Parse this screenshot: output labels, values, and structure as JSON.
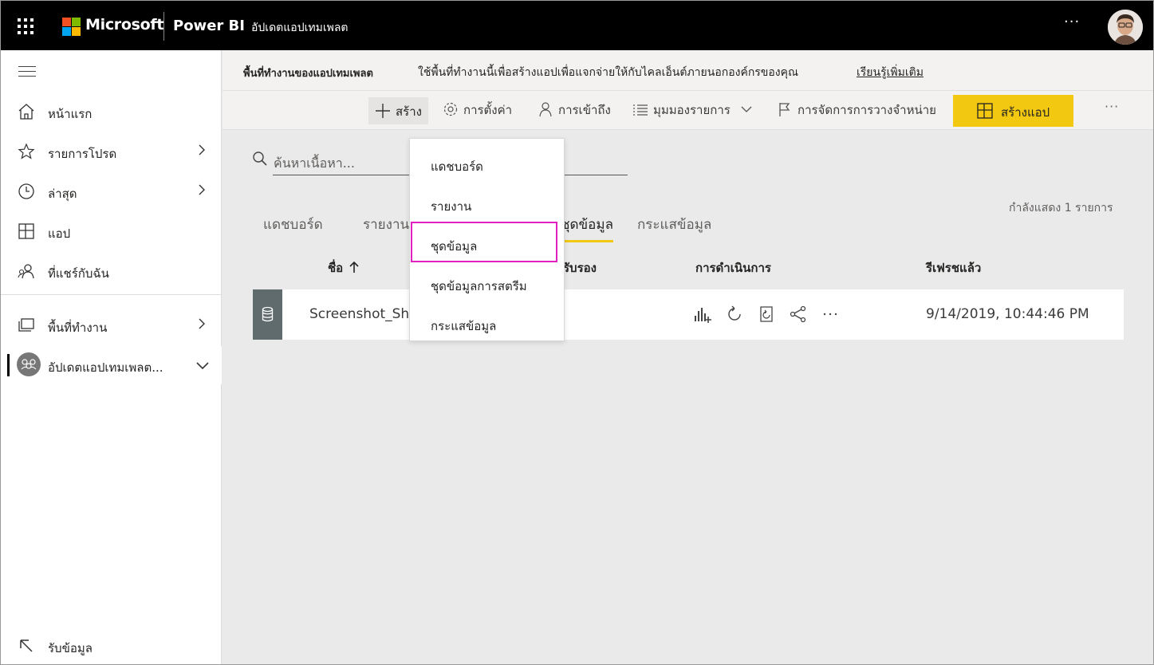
{
  "topbar": {
    "brand": "Microsoft",
    "product": "Power BI",
    "workspace_title": "อัปเดตแอปเทมเพลต",
    "more": "···",
    "icons": {
      "app_launcher": "waffle-icon",
      "avatar": "user-avatar"
    },
    "ms_colors": [
      "#f25022",
      "#7fba00",
      "#00a4ef",
      "#ffb900"
    ]
  },
  "sidebar": {
    "items": [
      {
        "label": "หน้าแรก",
        "icon": "home-icon"
      },
      {
        "label": "รายการโปรด",
        "icon": "star-icon"
      },
      {
        "label": "ล่าสุด",
        "icon": "clock-icon"
      },
      {
        "label": "แอป",
        "icon": "apps-icon"
      },
      {
        "label": "ที่แชร์กับฉัน",
        "icon": "shared-icon"
      },
      {
        "label": "พื้นที่ทำงาน",
        "icon": "workspaces-icon"
      },
      {
        "label": "อัปเดตแอปเทมเพลต...",
        "icon": "workspace-avatar-icon"
      }
    ],
    "get_data": "รับข้อมูล"
  },
  "infobar": {
    "title": "พื้นที่ทำงานของแอปเทมเพลต",
    "description": "ใช้พื้นที่ทำงานนี้เพื่อสร้างแอปเพื่อแจกจ่ายให้กับไคลเอ็นต์ภายนอกองค์กรของคุณ",
    "link": "เรียนรู้เพิ่มเติม"
  },
  "toolbar": {
    "create": "สร้าง",
    "settings": "การตั้งค่า",
    "access": "การเข้าถึง",
    "view": "มุมมองรายการ",
    "release": "การจัดการการวางจำหน่าย",
    "create_app": "สร้างแอป",
    "more": "···",
    "accent": "#f2c811"
  },
  "search": {
    "placeholder": "ค้นหาเนื้อหา..."
  },
  "showing": "กำลังแสดง 1 รายการ",
  "tabs": [
    "แดชบอร์ด",
    "รายงาน",
    "ชุดข้อมูล",
    "กระแสข้อมูล"
  ],
  "table": {
    "headers": {
      "name": "ชื่อ",
      "endorsement": "รับรอง",
      "actions": "การดำเนินการ",
      "refreshed": "รีเฟรชแล้ว"
    },
    "rows": [
      {
        "name": "Screenshot_Sh",
        "refreshed": "9/14/2019, 10:44:46 PM"
      }
    ]
  },
  "dropdown": {
    "items": [
      "แดชบอร์ด",
      "รายงาน",
      "ชุดข้อมูล",
      "ชุดข้อมูลการสตรีม",
      "กระแสข้อมูล"
    ],
    "highlight_color": "#e020c0"
  }
}
